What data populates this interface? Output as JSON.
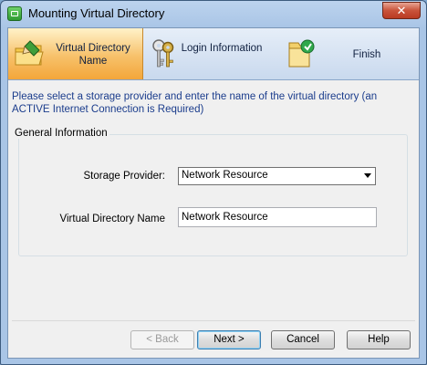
{
  "window": {
    "title": "Mounting Virtual Directory",
    "close_label": "✕"
  },
  "steps": [
    {
      "label": "Virtual Directory Name",
      "icon": "folder-pencil-icon",
      "active": true
    },
    {
      "label": "Login Information",
      "icon": "keys-icon",
      "active": false
    },
    {
      "label": "Finish",
      "icon": "finish-folder-icon",
      "active": false
    }
  ],
  "instructions": "Please select a storage provider and enter the name of the virtual directory (an ACTIVE Internet Connection is Required)",
  "group": {
    "title": "General Information",
    "storage_provider_label": "Storage Provider:",
    "storage_provider_value": "Network Resource",
    "directory_name_label": "Virtual Directory Name",
    "directory_name_value": "Network Resource"
  },
  "buttons": {
    "back": "< Back",
    "next": "Next >",
    "cancel": "Cancel",
    "help": "Help"
  },
  "colors": {
    "active_step": "#f3a63a",
    "instruction_text": "#1a3c8c",
    "frame": "#a9c5e6"
  }
}
